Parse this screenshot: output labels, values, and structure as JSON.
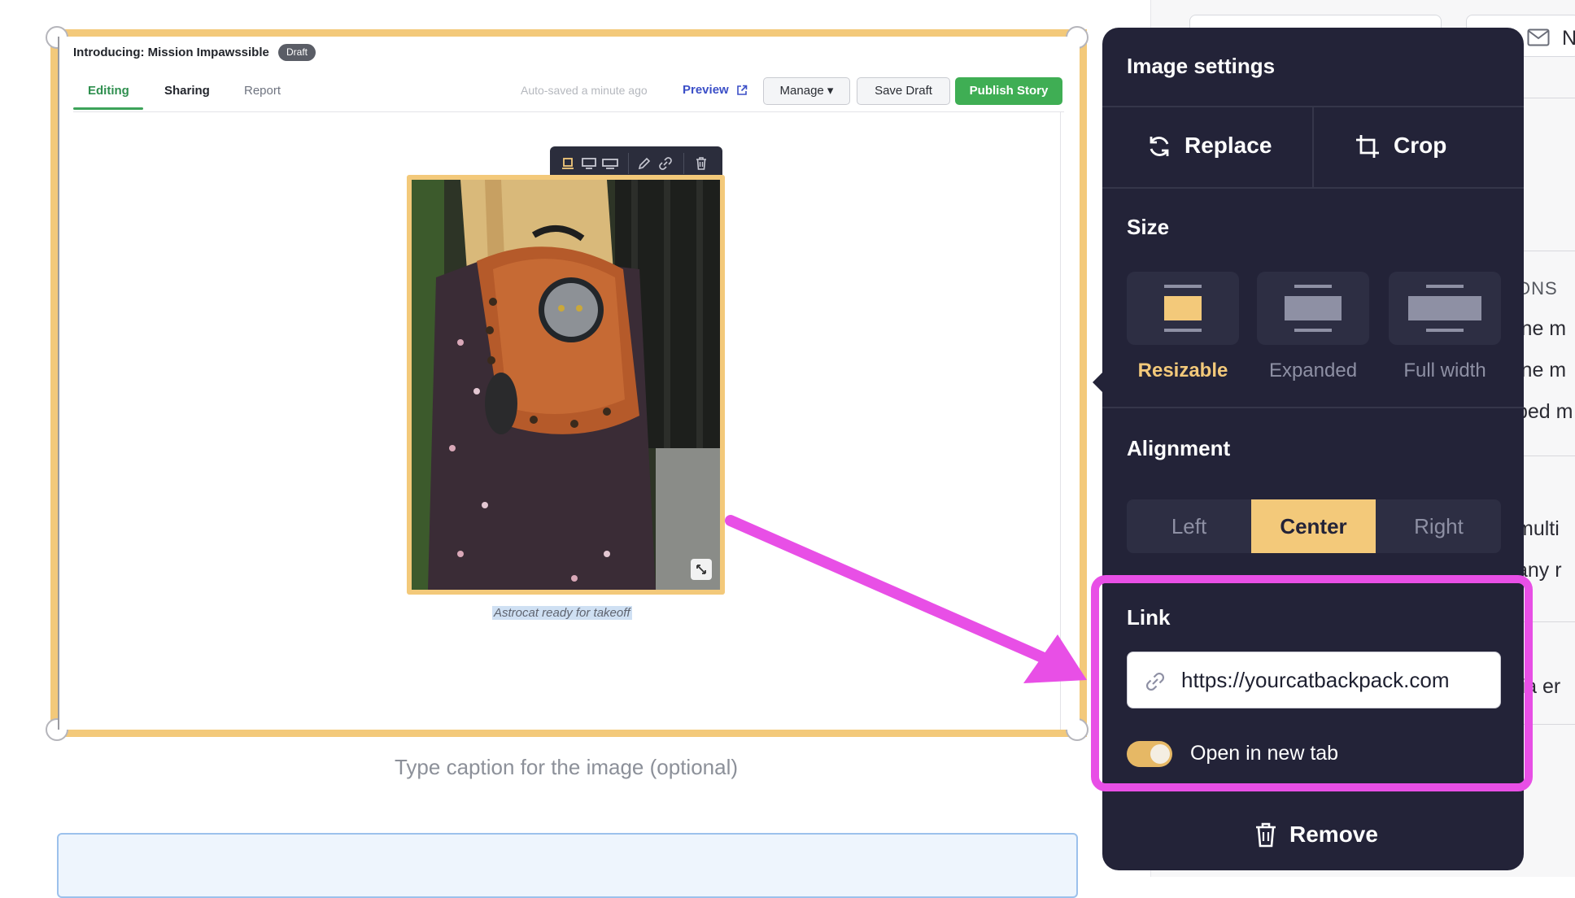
{
  "editor": {
    "story_title": "Introducing: Mission Impawssible",
    "status_badge": "Draft",
    "tabs": [
      {
        "label": "Editing",
        "active": true
      },
      {
        "label": "Sharing",
        "active": false
      },
      {
        "label": "Report",
        "active": false
      }
    ],
    "autosave_text": "Auto-saved a minute ago",
    "preview_label": "Preview",
    "manage_label": "Manage ▾",
    "save_draft_label": "Save Draft",
    "publish_label": "Publish Story",
    "image_caption": "Astrocat ready for takeoff",
    "caption_placeholder": "Type caption for the image (optional)"
  },
  "background_page": {
    "top_right_text": "N",
    "section_heading_fragment": "ONS",
    "text_fragments": [
      "ine m",
      "ine m",
      "ped m",
      "multi",
      "any r",
      "lia er"
    ]
  },
  "image_settings": {
    "title": "Image settings",
    "replace_label": "Replace",
    "crop_label": "Crop",
    "size": {
      "heading": "Size",
      "options": [
        {
          "label": "Resizable",
          "selected": true
        },
        {
          "label": "Expanded",
          "selected": false
        },
        {
          "label": "Full width",
          "selected": false
        }
      ]
    },
    "alignment": {
      "heading": "Alignment",
      "options": [
        {
          "label": "Left",
          "selected": false
        },
        {
          "label": "Center",
          "selected": true
        },
        {
          "label": "Right",
          "selected": false
        }
      ]
    },
    "link": {
      "heading": "Link",
      "value": "https://yourcatbackpack.com",
      "open_new_tab_label": "Open in new tab",
      "open_new_tab": true
    },
    "remove_label": "Remove"
  },
  "colors": {
    "panel_bg": "#232338",
    "accent_yellow": "#f3c97a",
    "publish_green": "#3fae54",
    "annotation_magenta": "#e84fe6"
  },
  "icons": [
    "external-link-icon",
    "refresh-icon",
    "crop-icon",
    "link-icon",
    "trash-icon",
    "mail-icon",
    "pencil-icon",
    "expand-icon"
  ]
}
